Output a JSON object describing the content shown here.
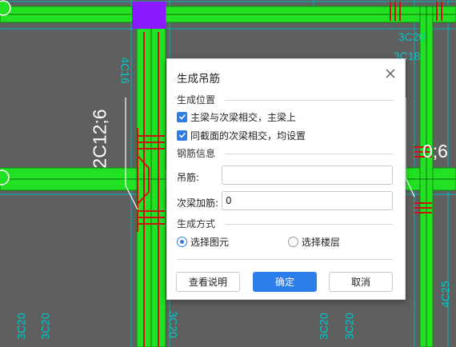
{
  "canvas": {
    "background_color": "#5f5f5f",
    "beam_color": "#22e122",
    "rebar_color": "#d01010",
    "highlight_color": "#8a1aff",
    "annotation_left": "2C12;6",
    "annotation_right": "0;6",
    "cyan_labels": [
      "4C16",
      "3C20",
      "3C18",
      "3C20",
      "3C20",
      "3C20",
      "3C20",
      "4C25",
      "3C20"
    ]
  },
  "dialog": {
    "title": "生成吊筋",
    "close_icon": "close-icon",
    "position_section": "生成位置",
    "option_main_beam": "主梁与次梁相交，主梁上",
    "option_main_beam_checked": true,
    "option_same_section": "同截面的次梁相交，均设置",
    "option_same_section_checked": true,
    "rebar_section": "钢筋信息",
    "hanger_label": "吊筋:",
    "hanger_value": "",
    "secondary_label": "次梁加筋:",
    "secondary_value": "0",
    "method_section": "生成方式",
    "radio_select_element": "选择图元",
    "radio_select_element_selected": true,
    "radio_select_floor": "选择楼层",
    "radio_select_floor_selected": false,
    "btn_help": "查看说明",
    "btn_ok": "确定",
    "btn_cancel": "取消",
    "accent_color": "#2b7de9"
  }
}
